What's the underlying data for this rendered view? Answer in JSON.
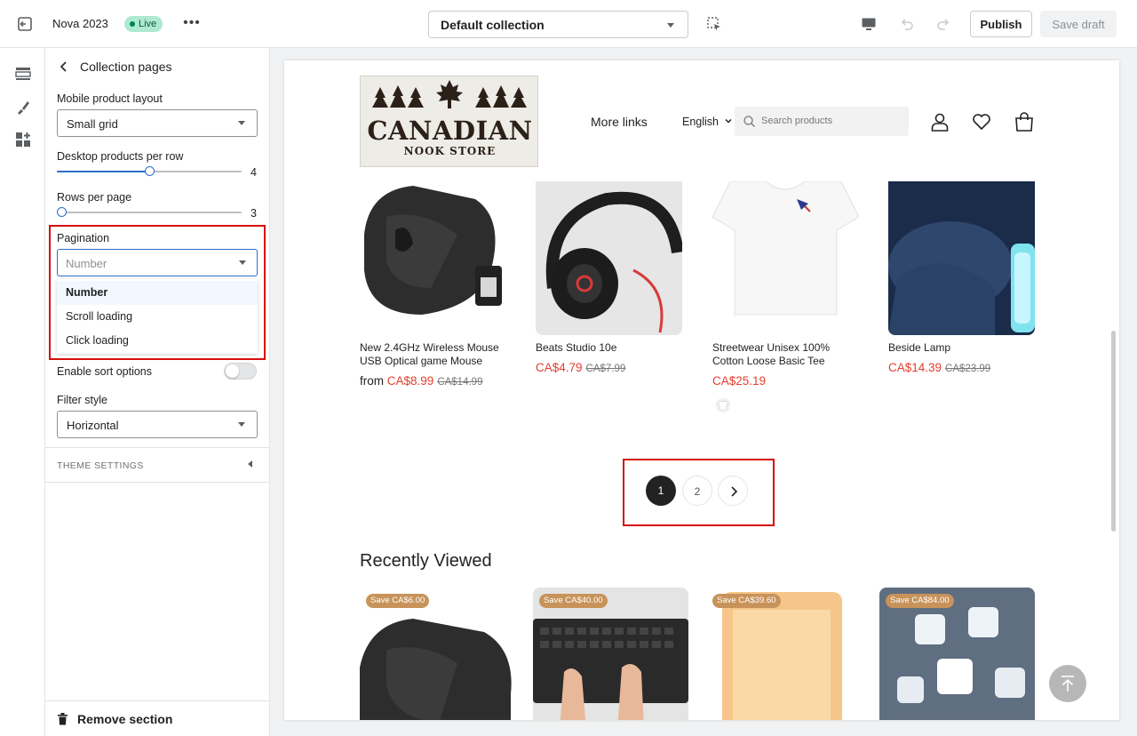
{
  "topbar": {
    "theme_name": "Nova 2023",
    "live_badge": "Live",
    "collection_select": "Default collection",
    "publish_label": "Publish",
    "save_draft_label": "Save draft"
  },
  "panel": {
    "title": "Collection pages",
    "mobile_layout_label": "Mobile product layout",
    "mobile_layout_value": "Small grid",
    "desktop_per_row_label": "Desktop products per row",
    "desktop_per_row_value": "4",
    "desktop_per_row_fraction": 0.5,
    "rows_per_page_label": "Rows per page",
    "rows_per_page_value": "3",
    "rows_per_page_fraction": 0.0,
    "pagination_label": "Pagination",
    "pagination_placeholder": "Number",
    "pagination_options": [
      "Number",
      "Scroll loading",
      "Click loading"
    ],
    "pagination_selected": "Number",
    "enable_sort_label": "Enable sort options",
    "enable_sort_on": false,
    "filter_style_label": "Filter style",
    "filter_style_value": "Horizontal",
    "theme_settings_label": "THEME SETTINGS",
    "remove_section_label": "Remove section"
  },
  "store": {
    "logo_text": "CANADIAN",
    "logo_subtext": "NOOK STORE",
    "nav_link": "More links",
    "language": "English",
    "search_placeholder": "Search products"
  },
  "products": [
    {
      "name": "New 2.4GHz Wireless Mouse USB Optical game Mouse",
      "prefix": "from ",
      "price": "CA$8.99",
      "old_price": "CA$14.99"
    },
    {
      "name": "Beats Studio 10e",
      "prefix": "",
      "price": "CA$4.79",
      "old_price": "CA$7.99"
    },
    {
      "name": "Streetwear Unisex 100% Cotton Loose Basic Tee",
      "prefix": "",
      "price": "CA$25.19",
      "old_price": ""
    },
    {
      "name": "Beside Lamp",
      "prefix": "",
      "price": "CA$14.39",
      "old_price": "CA$23.99"
    }
  ],
  "pagination": {
    "pages": [
      "1",
      "2"
    ],
    "current": "1"
  },
  "recently_viewed": {
    "title": "Recently Viewed",
    "badges": [
      "Save CA$6.00",
      "Save CA$40.00",
      "Save CA$39.60",
      "Save CA$84.00"
    ]
  },
  "colors": {
    "accent_blue": "#2c6ecb",
    "sale_red": "#e53e2d",
    "highlight_red": "#d60d0d",
    "live_green": "#aee9d1",
    "badge_tan": "#c8935a"
  }
}
